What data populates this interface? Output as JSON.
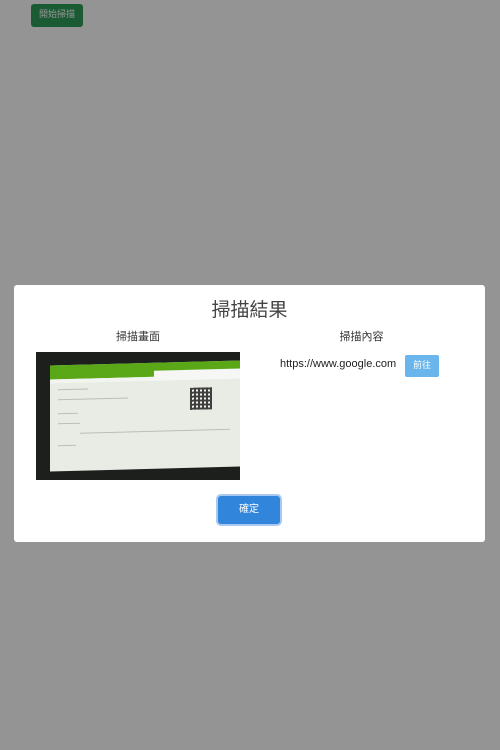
{
  "page": {
    "start_button_label": "開始掃描"
  },
  "modal": {
    "title": "掃描結果",
    "image_column_label": "掃描畫面",
    "content_column_label": "掃描內容",
    "scanned_url": "https://www.google.com",
    "go_button_label": "前往",
    "confirm_button_label": "確定"
  },
  "colors": {
    "start_button": "#2e9e5b",
    "go_button": "#69b5ec",
    "confirm_button": "#3186dc",
    "overlay": "rgba(0,0,0,0.42)"
  }
}
